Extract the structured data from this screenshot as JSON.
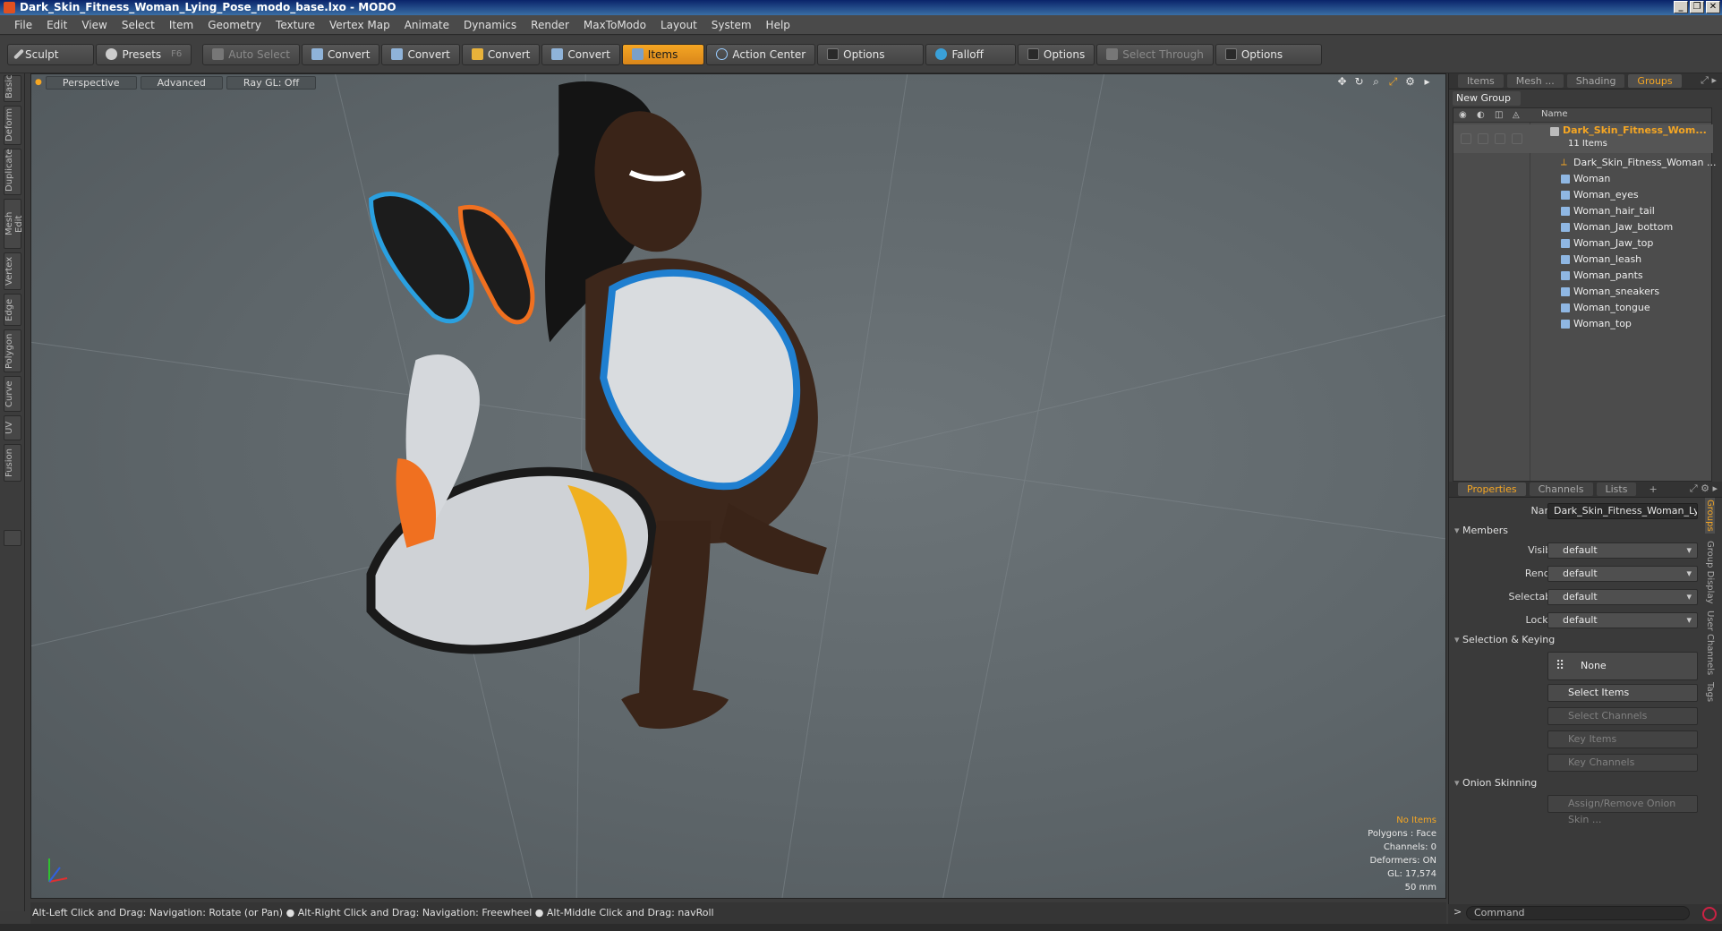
{
  "window": {
    "title": "Dark_Skin_Fitness_Woman_Lying_Pose_modo_base.lxo - MODO",
    "controls": [
      "_",
      "❐",
      "✕"
    ]
  },
  "menu": [
    "File",
    "Edit",
    "View",
    "Select",
    "Item",
    "Geometry",
    "Texture",
    "Vertex Map",
    "Animate",
    "Dynamics",
    "Render",
    "MaxToModo",
    "Layout",
    "System",
    "Help"
  ],
  "toolbar": {
    "sculpt": "Sculpt",
    "presets": "Presets",
    "presets_key": "F6",
    "auto_select": "Auto Select",
    "convert": "Convert",
    "items": "Items",
    "action_center": "Action Center",
    "options": "Options",
    "falloff": "Falloff",
    "select_through": "Select Through"
  },
  "left_tabs": [
    "Basic",
    "Deform",
    "Duplicate",
    "Mesh Edit",
    "Vertex",
    "Edge",
    "Polygon",
    "Curve",
    "UV",
    "Fusion"
  ],
  "viewport": {
    "tabs": [
      "Perspective",
      "Advanced",
      "Ray GL: Off"
    ],
    "stats": {
      "selection": "No Items",
      "polygons": "Polygons : Face",
      "channels": "Channels: 0",
      "deformers": "Deformers: ON",
      "gl": "GL: 17,574",
      "focal": "50 mm"
    }
  },
  "status": "Alt-Left Click and Drag: Navigation: Rotate (or Pan) ● Alt-Right Click and Drag: Navigation: Freewheel ● Alt-Middle Click and Drag: navRoll",
  "panel_top": {
    "tabs": [
      "Items",
      "Mesh ...",
      "Shading",
      "Groups"
    ],
    "active_tab": "Groups",
    "new_group": "New Group",
    "name_header": "Name",
    "group": {
      "name": "Dark_Skin_Fitness_Wom...",
      "count": "11 Items"
    },
    "items": [
      "Dark_Skin_Fitness_Woman ...",
      "Woman",
      "Woman_eyes",
      "Woman_hair_tail",
      "Woman_Jaw_bottom",
      "Woman_Jaw_top",
      "Woman_leash",
      "Woman_pants",
      "Woman_sneakers",
      "Woman_tongue",
      "Woman_top"
    ]
  },
  "panel_bottom": {
    "tabs": [
      "Properties",
      "Channels",
      "Lists",
      "+"
    ],
    "active_tab": "Properties",
    "name_label": "Name",
    "name_value": "Dark_Skin_Fitness_Woman_Lying",
    "members": "Members",
    "visible_label": "Visible",
    "render_label": "Render",
    "selectable_label": "Selectable",
    "locked_label": "Locked",
    "default": "default",
    "selection_keying": "Selection & Keying",
    "none": "None",
    "select_items": "Select Items",
    "select_channels": "Select Channels",
    "key_items": "Key Items",
    "key_channels": "Key Channels",
    "onion": "Onion Skinning",
    "assign_onion": "Assign/Remove Onion Skin ...",
    "side_tabs": [
      "Groups",
      "Group Display",
      "User Channels",
      "Tags"
    ]
  },
  "command": {
    "prompt": ">",
    "placeholder": "Command"
  },
  "colors": {
    "accent": "#f5a623",
    "viewport_bg": "#5e666a"
  }
}
